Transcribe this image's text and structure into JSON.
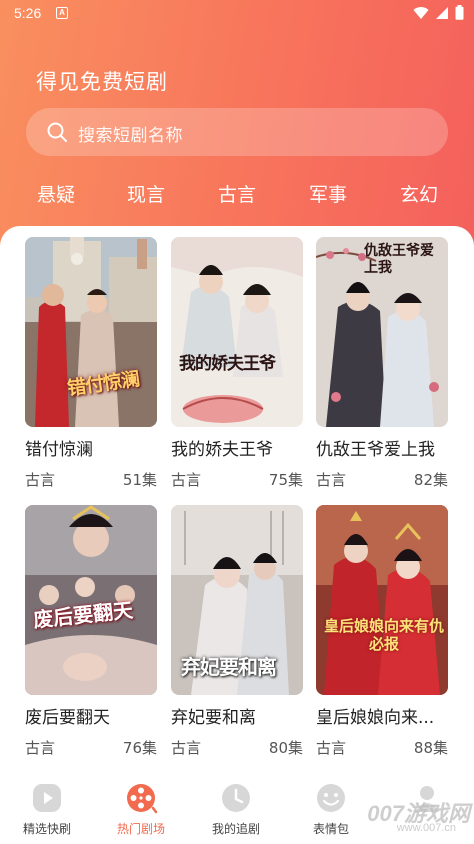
{
  "status": {
    "time": "5:26",
    "notify_letter": "A"
  },
  "header": {
    "title": "得见免费短剧",
    "search_placeholder": "搜索短剧名称"
  },
  "genres": [
    "悬疑",
    "现言",
    "古言",
    "军事",
    "玄幻"
  ],
  "dramas": [
    {
      "title": "错付惊澜",
      "genre": "古言",
      "episodes": "51集",
      "art_text": "错付惊澜"
    },
    {
      "title": "我的娇夫王爷",
      "genre": "古言",
      "episodes": "75集",
      "art_text": "我的娇夫王爷"
    },
    {
      "title": "仇敌王爷爱上我",
      "genre": "古言",
      "episodes": "82集",
      "art_text": "仇敌王爷爱上我"
    },
    {
      "title": "废后要翻天",
      "genre": "古言",
      "episodes": "76集",
      "art_text": "废后要翻天"
    },
    {
      "title": "弃妃要和离",
      "genre": "古言",
      "episodes": "80集",
      "art_text": "弃妃要和离"
    },
    {
      "title": "皇后娘娘向来...",
      "genre": "古言",
      "episodes": "88集",
      "art_text": "皇后娘娘向来有仇必报"
    }
  ],
  "nav": [
    {
      "label": "精选快刷",
      "icon": "play-icon"
    },
    {
      "label": "热门剧场",
      "icon": "film-reel-icon",
      "active": true
    },
    {
      "label": "我的追剧",
      "icon": "clock-icon"
    },
    {
      "label": "表情包",
      "icon": "smiley-icon"
    },
    {
      "label": "",
      "icon": "profile-icon"
    }
  ],
  "watermark": {
    "main": "007游戏网",
    "sub": "www.007.cn"
  },
  "colors": {
    "accent": "#f26b4e",
    "header_start": "#f98f5f",
    "header_end": "#f4605c"
  }
}
